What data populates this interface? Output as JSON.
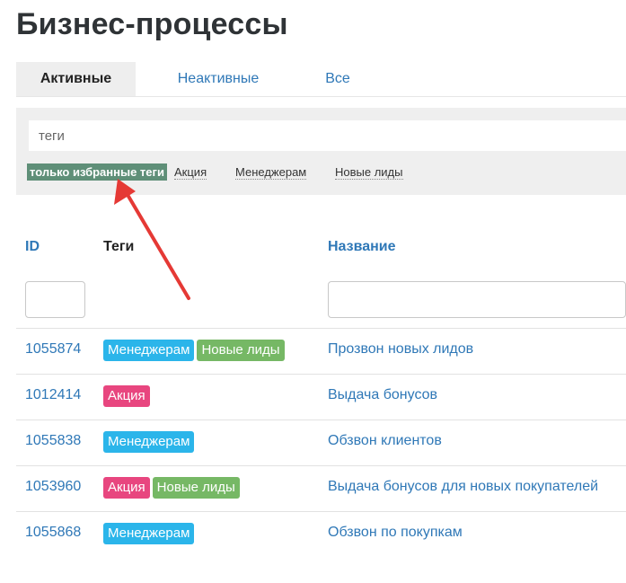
{
  "page": {
    "title": "Бизнес-процессы"
  },
  "tabs": [
    {
      "label": "Активные",
      "active": true
    },
    {
      "label": "Неактивные",
      "active": false
    },
    {
      "label": "Все",
      "active": false
    }
  ],
  "filter": {
    "tags_placeholder": "теги",
    "favorites_label": "только избранные теги",
    "quick_tags": [
      "Акция",
      "Менеджерам",
      "Новые лиды"
    ]
  },
  "table": {
    "headers": {
      "id": "ID",
      "tags": "Теги",
      "name": "Название"
    },
    "rows": [
      {
        "id": "1055874",
        "tags": [
          "Менеджерам",
          "Новые лиды"
        ],
        "name": "Прозвон новых лидов"
      },
      {
        "id": "1012414",
        "tags": [
          "Акция"
        ],
        "name": "Выдача бонусов"
      },
      {
        "id": "1055838",
        "tags": [
          "Менеджерам"
        ],
        "name": "Обзвон клиентов"
      },
      {
        "id": "1053960",
        "tags": [
          "Акция",
          "Новые лиды"
        ],
        "name": "Выдача бонусов для новых покупателей"
      },
      {
        "id": "1055868",
        "tags": [
          "Менеджерам"
        ],
        "name": "Обзвон по покупкам"
      }
    ]
  },
  "colors": {
    "link": "#2f78b7",
    "favorites": "#5f8f78",
    "tag_Менеджерам": "#2bb5ea",
    "tag_Новые лиды": "#76b865",
    "tag_Акция": "#e8467f",
    "annotation_arrow": "#e53935"
  },
  "annotation": {
    "type": "arrow",
    "target": "favorites-tags-button"
  }
}
